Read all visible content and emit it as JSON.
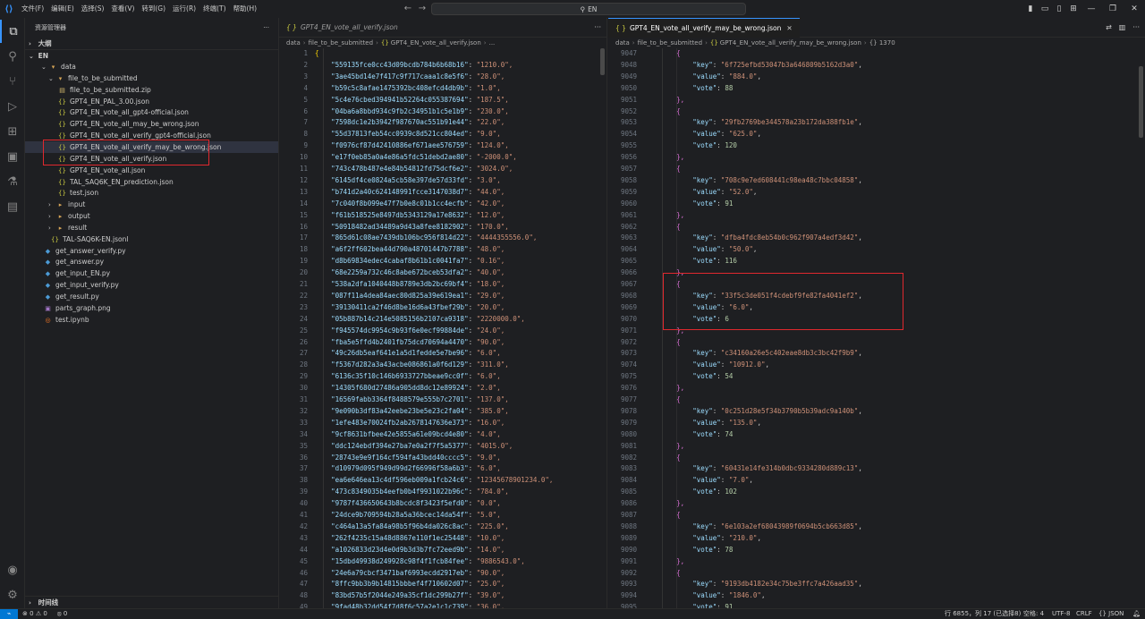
{
  "titlebar": {
    "menus": [
      "文件(F)",
      "编辑(E)",
      "选择(S)",
      "查看(V)",
      "转到(G)",
      "运行(R)",
      "终端(T)",
      "帮助(H)"
    ],
    "search_text": "EN"
  },
  "sidebar": {
    "title": "资源管理器",
    "outline_label": "大纲",
    "root": "EN",
    "timeline_label": "时间线",
    "tree": [
      {
        "label": "data",
        "type": "folder-open",
        "depth": 1
      },
      {
        "label": "file_to_be_submitted",
        "type": "folder-open",
        "depth": 2
      },
      {
        "label": "file_to_be_submitted.zip",
        "type": "zip",
        "depth": 3
      },
      {
        "label": "GPT4_EN_PAL_3.00.json",
        "type": "json",
        "depth": 3
      },
      {
        "label": "GPT4_EN_vote_all_gpt4-official.json",
        "type": "json",
        "depth": 3
      },
      {
        "label": "GPT4_EN_vote_all_may_be_wrong.json",
        "type": "json",
        "depth": 3
      },
      {
        "label": "GPT4_EN_vote_all_verify_gpt4-official.json",
        "type": "json",
        "depth": 3
      },
      {
        "label": "GPT4_EN_vote_all_verify_may_be_wrong.json",
        "type": "json",
        "depth": 3
      },
      {
        "label": "GPT4_EN_vote_all_verify.json",
        "type": "json",
        "depth": 3
      },
      {
        "label": "GPT4_EN_vote_all.json",
        "type": "json",
        "depth": 3
      },
      {
        "label": "TAL_SAQ6K_EN_prediction.json",
        "type": "json",
        "depth": 3
      },
      {
        "label": "test.json",
        "type": "json",
        "depth": 3
      },
      {
        "label": "input",
        "type": "folder",
        "depth": 2
      },
      {
        "label": "output",
        "type": "folder",
        "depth": 2
      },
      {
        "label": "result",
        "type": "folder",
        "depth": 2
      },
      {
        "label": "TAL-SAQ6K-EN.jsonl",
        "type": "json",
        "depth": 2
      },
      {
        "label": "get_answer_verify.py",
        "type": "py",
        "depth": 1
      },
      {
        "label": "get_answer.py",
        "type": "py",
        "depth": 1
      },
      {
        "label": "get_input_EN.py",
        "type": "py",
        "depth": 1
      },
      {
        "label": "get_input_verify.py",
        "type": "py",
        "depth": 1
      },
      {
        "label": "get_result.py",
        "type": "py",
        "depth": 1
      },
      {
        "label": "parts_graph.png",
        "type": "png",
        "depth": 1
      },
      {
        "label": "test.ipynb",
        "type": "nb",
        "depth": 1
      }
    ]
  },
  "editor1": {
    "tab_label": "GPT4_EN_vote_all_verify.json",
    "breadcrumb": [
      "data",
      "file_to_be_submitted",
      "GPT4_EN_vote_all_verify.json",
      "..."
    ],
    "lines": [
      {
        "n": "1",
        "k": "",
        "v": "{"
      },
      {
        "n": "2",
        "k": "\"559135fce0cc43d09bcdb784b6b68b16\"",
        "v": "\"1210.0\","
      },
      {
        "n": "3",
        "k": "\"3ae45bd14e7f417c9f717caaa1c8e5f6\"",
        "v": "\"28.0\","
      },
      {
        "n": "4",
        "k": "\"b59c5c8afae1475392bc408efcd4db9b\"",
        "v": "\"1.0\","
      },
      {
        "n": "5",
        "k": "\"5c4e76cbed394941b52264c055387694\"",
        "v": "\"187.5\","
      },
      {
        "n": "6",
        "k": "\"04ba6a8bbd934c9fb2c34951b1c5e1b9\"",
        "v": "\"230.0\","
      },
      {
        "n": "7",
        "k": "\"7598dc1e2b3942f987670ac551b91e44\"",
        "v": "\"22.0\","
      },
      {
        "n": "8",
        "k": "\"55d37813feb54cc0939c8d521cc804ed\"",
        "v": "\"9.0\","
      },
      {
        "n": "9",
        "k": "\"f0976cf87d42410886ef671aee576759\"",
        "v": "\"124.0\","
      },
      {
        "n": "10",
        "k": "\"e17f0eb85a0a4e86a5fdc51debd2ae80\"",
        "v": "\"-2000.0\","
      },
      {
        "n": "11",
        "k": "\"743c478b487e4e84b54812fd75dcf6e2\"",
        "v": "\"3024.0\","
      },
      {
        "n": "12",
        "k": "\"6145df4ce0824a5cb58e397de57d33fd\"",
        "v": "\"3.0\","
      },
      {
        "n": "13",
        "k": "\"b741d2a40c624148991fcce3147038d7\"",
        "v": "\"44.0\","
      },
      {
        "n": "14",
        "k": "\"7c040f8b099e47f7b0e8c01b1cc4ecfb\"",
        "v": "\"42.0\","
      },
      {
        "n": "15",
        "k": "\"f61b518525e8497db5343129a17e8632\"",
        "v": "\"12.0\","
      },
      {
        "n": "16",
        "k": "\"50918482ad34489a9d43a8fee8182902\"",
        "v": "\"170.0\","
      },
      {
        "n": "17",
        "k": "\"865d61c08ae7439db106bc956f814d22\"",
        "v": "\"4444355556.0\","
      },
      {
        "n": "18",
        "k": "\"a6f2ff602bea44d790a48701447b7788\"",
        "v": "\"48.0\","
      },
      {
        "n": "19",
        "k": "\"d8b69834edec4cabaf8b61b1c0041fa7\"",
        "v": "\"0.16\","
      },
      {
        "n": "20",
        "k": "\"68e2259a732c46c8abe672bceb53dfa2\"",
        "v": "\"40.0\","
      },
      {
        "n": "21",
        "k": "\"538a2dfa1040448b8789e3db2bc69bf4\"",
        "v": "\"18.0\","
      },
      {
        "n": "22",
        "k": "\"087f11a4dea84aec80d825a39e619ea1\"",
        "v": "\"29.0\","
      },
      {
        "n": "23",
        "k": "\"39130411ca2f46d8be16d6a43fbef29b\"",
        "v": "\"20.0\","
      },
      {
        "n": "24",
        "k": "\"05b887b14c214e5085156b2107ca9318\"",
        "v": "\"2220000.0\","
      },
      {
        "n": "25",
        "k": "\"f945574dc9954c9b93f6e0ecf99884de\"",
        "v": "\"24.0\","
      },
      {
        "n": "26",
        "k": "\"fba5e5ffd4b2401fb75dcd70694a4470\"",
        "v": "\"90.0\","
      },
      {
        "n": "27",
        "k": "\"49c26db5eaf641e1a5d1fedde5e7be96\"",
        "v": "\"6.0\","
      },
      {
        "n": "28",
        "k": "\"f5367d282a3a43acbe086861a0f6d129\"",
        "v": "\"311.0\","
      },
      {
        "n": "29",
        "k": "\"6136c35f10c146b6933727bbeae9cc0f\"",
        "v": "\"6.0\","
      },
      {
        "n": "30",
        "k": "\"14305f680d27486a905dd8dc12e89924\"",
        "v": "\"2.0\","
      },
      {
        "n": "31",
        "k": "\"16569fabb3364f8488579e555b7c2701\"",
        "v": "\"137.0\","
      },
      {
        "n": "32",
        "k": "\"9e090b3df83a42eebe23be5e23c2fa04\"",
        "v": "\"385.0\","
      },
      {
        "n": "33",
        "k": "\"1efe483e70024fb2ab2678147636e373\"",
        "v": "\"16.0\","
      },
      {
        "n": "34",
        "k": "\"9cf8631bfbee42e5855a61e09bcd4e80\"",
        "v": "\"4.0\","
      },
      {
        "n": "35",
        "k": "\"ddc124ebdf394e27ba7e0a2f7f5a5377\"",
        "v": "\"4015.0\","
      },
      {
        "n": "36",
        "k": "\"28743e9e9f164cf594fa43bdd40cccc5\"",
        "v": "\"9.0\","
      },
      {
        "n": "37",
        "k": "\"d10979d095f949d99d2f66996f58a6b3\"",
        "v": "\"6.0\","
      },
      {
        "n": "38",
        "k": "\"ea6e646ea13c4df596eb009a1fcb24c6\"",
        "v": "\"12345678901234.0\","
      },
      {
        "n": "39",
        "k": "\"473c8349035b4eefb0b4f9931022b96c\"",
        "v": "\"784.0\","
      },
      {
        "n": "40",
        "k": "\"9787f436650643b8bcdc8f3423f5efd0\"",
        "v": "\"0.0\","
      },
      {
        "n": "41",
        "k": "\"24dce9b709594b28a5a36bcec14da54f\"",
        "v": "\"5.0\","
      },
      {
        "n": "42",
        "k": "\"c464a13a5fa84a98b5f96b4da026c8ac\"",
        "v": "\"225.0\","
      },
      {
        "n": "43",
        "k": "\"262f4235c15a48d8867e110f1ec25448\"",
        "v": "\"10.0\","
      },
      {
        "n": "44",
        "k": "\"a1026833d23d4e0d9b3d3b7fc72eed9b\"",
        "v": "\"14.0\","
      },
      {
        "n": "45",
        "k": "\"15dbd49938d249928c98f4f1fcb84fee\"",
        "v": "\"9886543.0\","
      },
      {
        "n": "46",
        "k": "\"24e6a79cbcf3471baf6993ecdd2917eb\"",
        "v": "\"90.0\","
      },
      {
        "n": "47",
        "k": "\"8ffc9bb3b9b14815bbbef4f710602d07\"",
        "v": "\"25.0\","
      },
      {
        "n": "48",
        "k": "\"83bd57b5f2044e249a35cf1dc299b27f\"",
        "v": "\"39.0\","
      },
      {
        "n": "49",
        "k": "\"9fad48b32dd54f7d8f6c57a2e1c1c739\"",
        "v": "\"36.0\","
      }
    ]
  },
  "editor2": {
    "tab_label": "GPT4_EN_vote_all_verify_may_be_wrong.json",
    "breadcrumb": [
      "data",
      "file_to_be_submitted",
      "GPT4_EN_vote_all_verify_may_be_wrong.json",
      "{} 1370"
    ],
    "records": [
      {
        "start": 9048,
        "key": "6f725efbd53047b3a646809b5162d3a0",
        "value": "884.0",
        "vote": "88"
      },
      {
        "start": 9053,
        "key": "29fb2769be344578a23b172da388fb1e",
        "value": "625.0",
        "vote": "120"
      },
      {
        "start": 9058,
        "key": "708c9e7ed608441c98ea48c7bbc04858",
        "value": "52.0",
        "vote": "91"
      },
      {
        "start": 9063,
        "key": "dfba4fdc8eb54b0c962f907a4edf3d42",
        "value": "50.0",
        "vote": "116"
      },
      {
        "start": 9068,
        "key": "33f5c3de051f4cdebf9fe82fa4041ef2",
        "value": "6.0",
        "vote": "6"
      },
      {
        "start": 9073,
        "key": "c34160a26e5c402eae8db3c3bc42f9b9",
        "value": "10912.0",
        "vote": "54"
      },
      {
        "start": 9078,
        "key": "0c251d28e5f34b3790b5b39adc9a140b",
        "value": "135.0",
        "vote": "74"
      },
      {
        "start": 9083,
        "key": "60431e14fe314b0dbc9334280d889c13",
        "value": "7.0",
        "vote": "102"
      },
      {
        "start": 9088,
        "key": "6e103a2ef68043989f0694b5cb663d85",
        "value": "210.0",
        "vote": "78"
      },
      {
        "start": 9093,
        "key": "9193db4182e34c75be3ffc7a426aad35",
        "value": "1846.0",
        "vote": "91"
      }
    ]
  },
  "statusbar": {
    "errors": "0",
    "warnings": "0",
    "ports": "0",
    "cursor": "行 6855，列 17 (已选择8)",
    "spaces": "空格: 4",
    "encoding": "UTF-8",
    "eol": "CRLF",
    "language": "{} JSON"
  },
  "colors": {
    "accent": "#3794ff",
    "highlight_box": "#e0282e"
  }
}
